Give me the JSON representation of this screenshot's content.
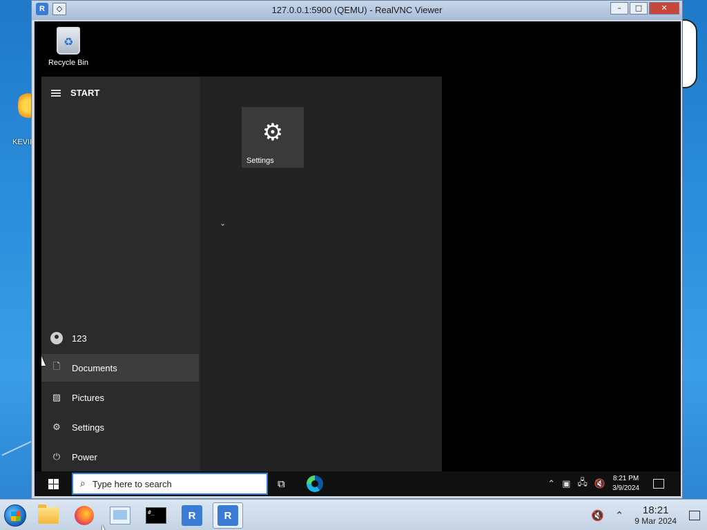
{
  "host": {
    "desktop_icon_label": "KEVIN",
    "clock": {
      "time": "18:21",
      "date": "9 Mar 2024"
    }
  },
  "window": {
    "app_icon": "R",
    "title": "127.0.0.1:5900 (QEMU) - RealVNC Viewer",
    "minimize": "–",
    "maximize": "□",
    "close": "✕"
  },
  "remote": {
    "desktop": {
      "recycle_bin_label": "Recycle Bin"
    },
    "start_menu": {
      "title": "START",
      "user": "123",
      "items": [
        {
          "label": "Documents",
          "icon": "document-icon"
        },
        {
          "label": "Pictures",
          "icon": "picture-icon"
        },
        {
          "label": "Settings",
          "icon": "gear-icon"
        },
        {
          "label": "Power",
          "icon": "power-icon"
        }
      ],
      "tile": {
        "label": "Settings",
        "icon": "gear-icon"
      }
    },
    "taskbar": {
      "search_placeholder": "Type here to search",
      "clock": {
        "time": "8:21 PM",
        "date": "3/9/2024"
      }
    }
  },
  "colors": {
    "host_desktop": "#2b8fdc",
    "start_menu_bg": "#232323",
    "start_left_bg": "#2b2b2b",
    "search_border": "#2d7fd8",
    "close_button": "#c9463b"
  }
}
